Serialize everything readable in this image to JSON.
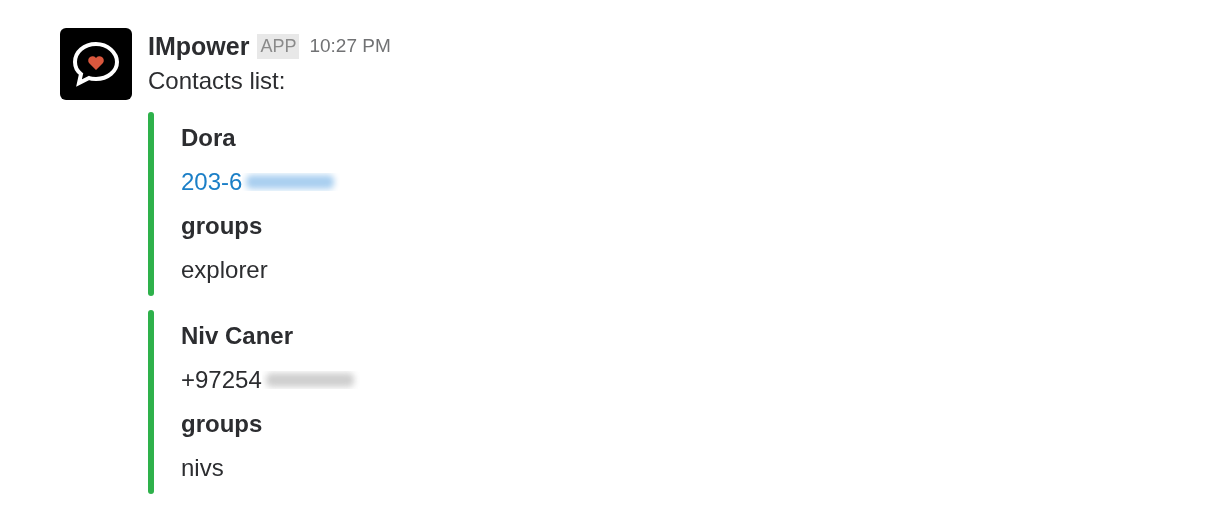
{
  "message": {
    "sender": "IMpower",
    "badge": "APP",
    "time": "10:27 PM",
    "text": "Contacts list:"
  },
  "attachments": [
    {
      "color": "#2eb14b",
      "title": "Dora",
      "lines": [
        {
          "kind": "link",
          "text": "203-6",
          "redacted": true
        },
        {
          "kind": "label",
          "text": "groups"
        },
        {
          "kind": "plain",
          "text": "explorer"
        }
      ]
    },
    {
      "color": "#2eb14b",
      "title": "Niv Caner",
      "lines": [
        {
          "kind": "plain",
          "text": "+97254",
          "redacted": true
        },
        {
          "kind": "label",
          "text": "groups"
        },
        {
          "kind": "plain",
          "text": "nivs"
        }
      ]
    }
  ]
}
